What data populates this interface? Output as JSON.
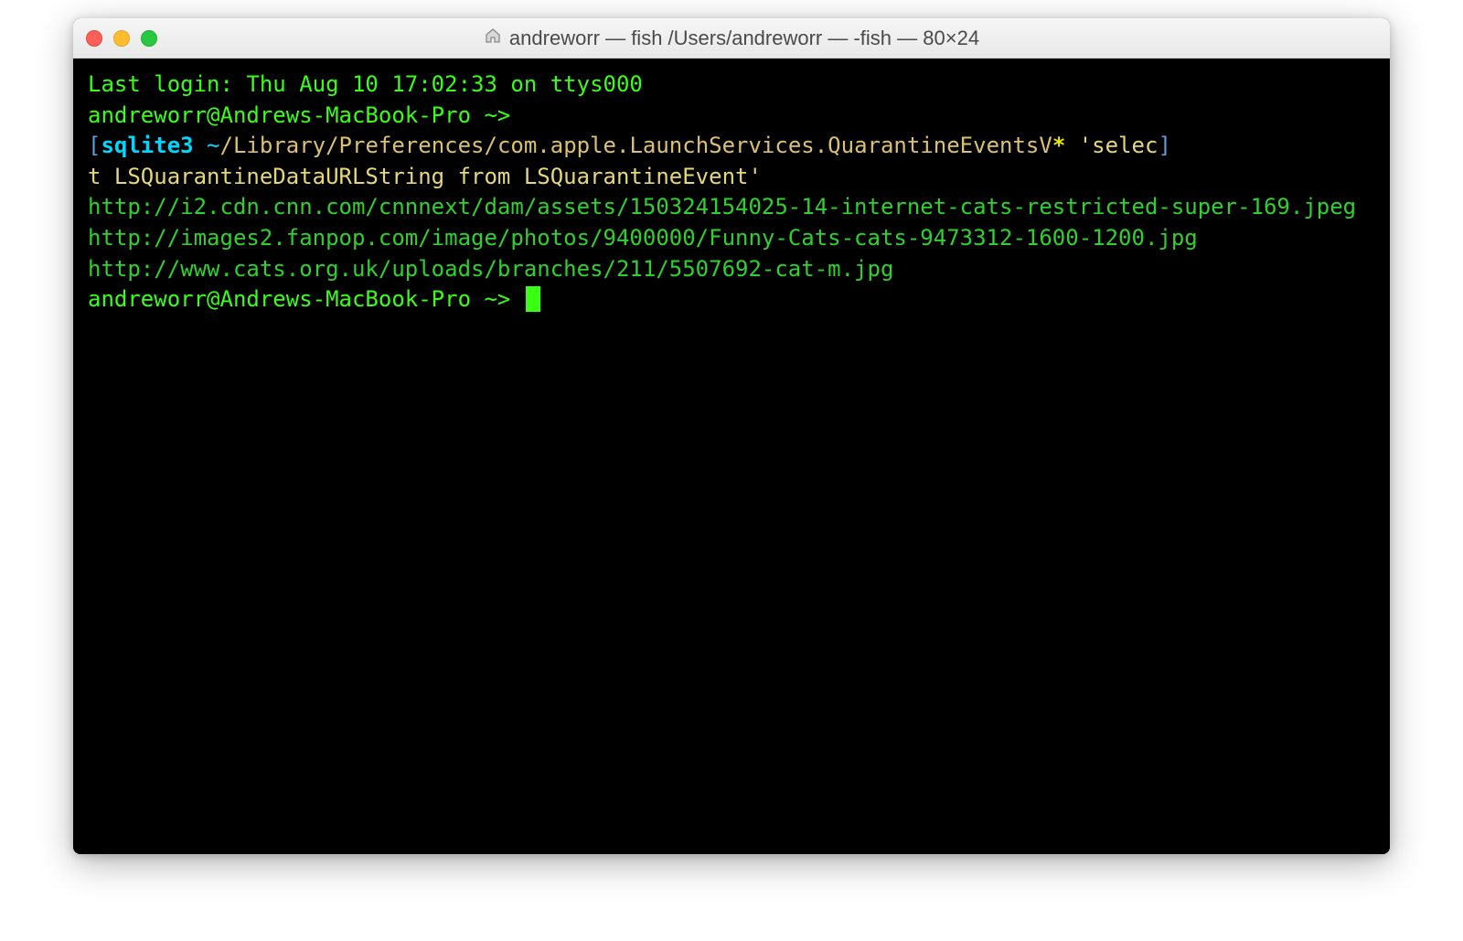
{
  "titlebar": {
    "title": "andreworr — fish  /Users/andreworr — -fish — 80×24",
    "home_icon": "⌂"
  },
  "terminal": {
    "last_login": "Last login: Thu Aug 10 17:02:33 on ttys000",
    "prompt1": "andreworr@Andrews-MacBook-Pro ~>",
    "bracket_open": "[",
    "bracket_close": "]",
    "command_sqlite": "sqlite3",
    "command_path_tilde": " ~",
    "command_path": "/Library/Preferences/com.apple.LaunchServices.QuarantineEventsV",
    "command_asterisk": "*",
    "command_sql_part1": " 'selec",
    "command_sql_part2": "t LSQuarantineDataURLString from LSQuarantineEvent'",
    "output": [
      "http://i2.cdn.cnn.com/cnnnext/dam/assets/150324154025-14-internet-cats-restricted-super-169.jpeg",
      "http://images2.fanpop.com/image/photos/9400000/Funny-Cats-cats-9473312-1600-1200.jpg",
      "http://www.cats.org.uk/uploads/branches/211/5507692-cat-m.jpg"
    ],
    "prompt2": "andreworr@Andrews-MacBook-Pro ~> "
  }
}
